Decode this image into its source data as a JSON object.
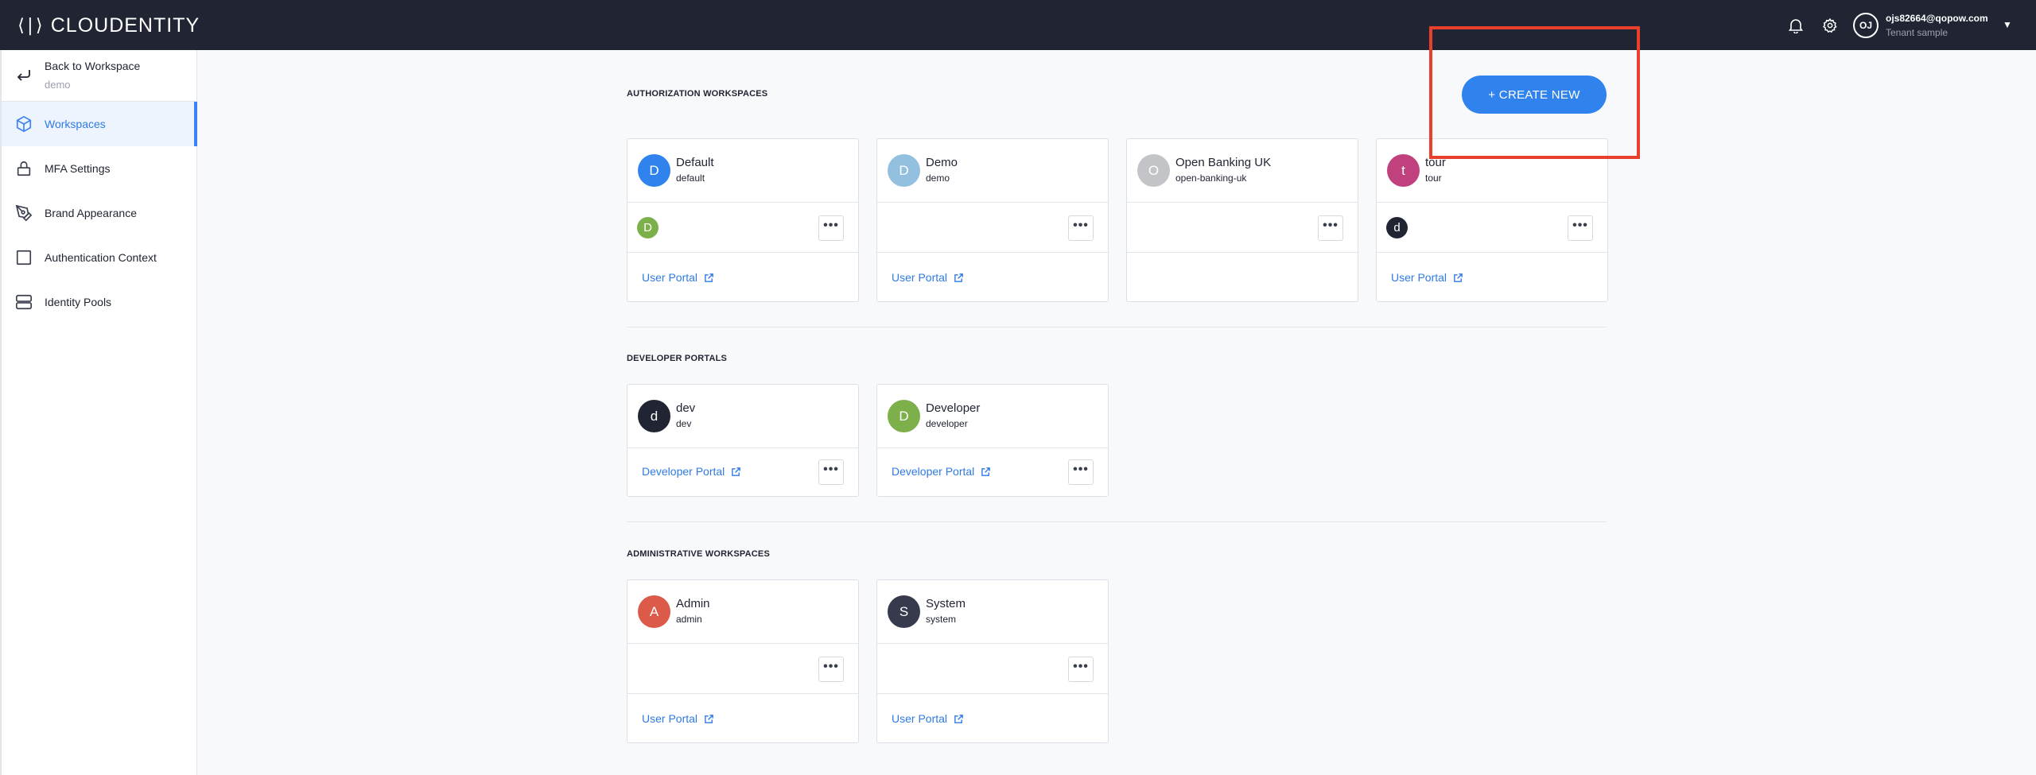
{
  "header": {
    "brand": "CLOUDENTITY",
    "brand_mark": "⟨|⟩",
    "user_initials": "OJ",
    "user_email": "ojs82664@qopow.com",
    "tenant": "Tenant sample",
    "icons": [
      "bell-icon",
      "gear-icon",
      "chevron-down-icon"
    ]
  },
  "sidebar": {
    "back_label": "Back to Workspace",
    "back_sub": "demo",
    "items": [
      {
        "label": "Workspaces",
        "icon": "cube-icon",
        "active": true
      },
      {
        "label": "MFA Settings",
        "icon": "lock-icon",
        "active": false
      },
      {
        "label": "Brand Appearance",
        "icon": "pen-tool-icon",
        "active": false
      },
      {
        "label": "Authentication Context",
        "icon": "square-icon",
        "active": false
      },
      {
        "label": "Identity Pools",
        "icon": "server-icon",
        "active": false
      }
    ]
  },
  "main": {
    "create_button": "+ CREATE NEW",
    "sections": [
      {
        "title": "AUTHORIZATION WORKSPACES",
        "cards": [
          {
            "initial": "D",
            "color": "#3082ed",
            "name": "Default",
            "id": "default",
            "mini_initial": "D",
            "mini_color": "#7db04a",
            "link": "User Portal"
          },
          {
            "initial": "D",
            "color": "#94c0e0",
            "name": "Demo",
            "id": "demo",
            "mini_initial": "",
            "mini_color": "",
            "link": "User Portal"
          },
          {
            "initial": "O",
            "color": "#c2c4c8",
            "name": "Open Banking UK",
            "id": "open-banking-uk",
            "mini_initial": "",
            "mini_color": "",
            "link": ""
          },
          {
            "initial": "t",
            "color": "#c0417e",
            "name": "tour",
            "id": "tour",
            "mini_initial": "d",
            "mini_color": "#212533",
            "link": "User Portal"
          }
        ]
      },
      {
        "title": "DEVELOPER PORTALS",
        "cards": [
          {
            "initial": "d",
            "color": "#212533",
            "name": "dev",
            "id": "dev",
            "link": "Developer Portal"
          },
          {
            "initial": "D",
            "color": "#7db04a",
            "name": "Developer",
            "id": "developer",
            "link": "Developer Portal"
          }
        ]
      },
      {
        "title": "ADMINISTRATIVE WORKSPACES",
        "cards": [
          {
            "initial": "A",
            "color": "#dc5a49",
            "name": "Admin",
            "id": "admin",
            "link": "User Portal"
          },
          {
            "initial": "S",
            "color": "#363a4c",
            "name": "System",
            "id": "system",
            "link": "User Portal"
          }
        ]
      }
    ],
    "more_label": "•••"
  },
  "colors": {
    "topbar": "#212533",
    "accent": "#3082ed",
    "highlight": "#e8402c"
  }
}
